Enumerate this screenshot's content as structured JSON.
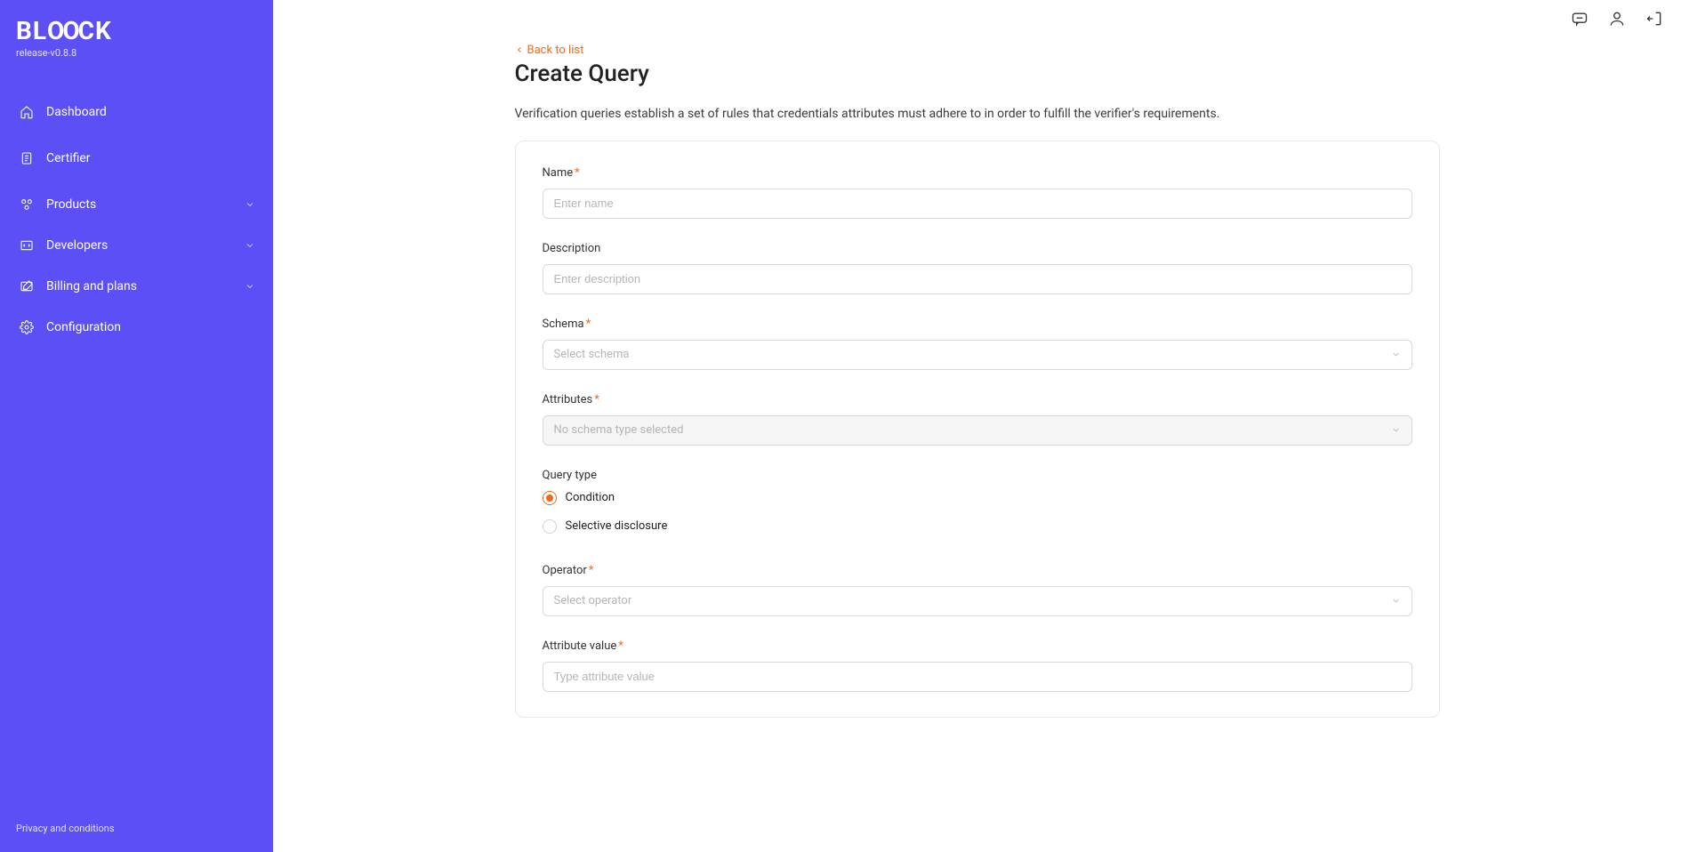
{
  "brand": {
    "name": "BLOOCK",
    "release": "release-v0.8.8"
  },
  "sidebar": {
    "items": [
      {
        "label": "Dashboard"
      },
      {
        "label": "Certifier"
      },
      {
        "label": "Products"
      },
      {
        "label": "Developers"
      },
      {
        "label": "Billing and plans"
      },
      {
        "label": "Configuration"
      }
    ],
    "footer": "Privacy and conditions"
  },
  "page": {
    "back": "Back to list",
    "title": "Create Query",
    "desc": "Verification queries establish a set of rules that credentials attributes must adhere to in order to fulfill the verifier's requirements."
  },
  "form": {
    "name": {
      "label": "Name",
      "placeholder": "Enter name"
    },
    "description": {
      "label": "Description",
      "placeholder": "Enter description"
    },
    "schema": {
      "label": "Schema",
      "placeholder": "Select schema"
    },
    "attributes": {
      "label": "Attributes",
      "placeholder": "No schema type selected"
    },
    "query_type": {
      "label": "Query type",
      "options": [
        {
          "label": "Condition",
          "selected": true
        },
        {
          "label": "Selective disclosure",
          "selected": false
        }
      ]
    },
    "operator": {
      "label": "Operator",
      "placeholder": "Select operator"
    },
    "attribute_value": {
      "label": "Attribute value",
      "placeholder": "Type attribute value"
    }
  }
}
